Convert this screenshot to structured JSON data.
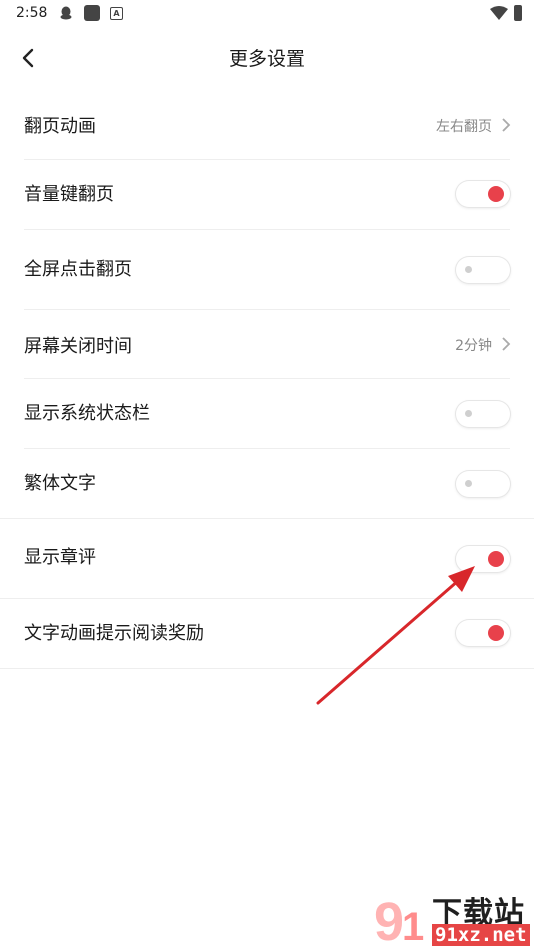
{
  "status_bar": {
    "time": "2:58"
  },
  "header": {
    "title": "更多设置"
  },
  "settings": {
    "page_turn_animation": {
      "label": "翻页动画",
      "value": "左右翻页"
    },
    "volume_key_page_turn": {
      "label": "音量键翻页",
      "enabled": true
    },
    "fullscreen_tap_page_turn": {
      "label": "全屏点击翻页",
      "enabled": false
    },
    "screen_off_time": {
      "label": "屏幕关闭时间",
      "value": "2分钟"
    },
    "show_status_bar": {
      "label": "显示系统状态栏",
      "enabled": false
    },
    "traditional_text": {
      "label": "繁体文字",
      "enabled": false
    },
    "show_chapter_comments": {
      "label": "显示章评",
      "enabled": true
    },
    "text_animation_reading_reward": {
      "label": "文字动画提示阅读奖励",
      "enabled": true
    }
  },
  "colors": {
    "toggle_on": "#e8414b",
    "annotation_arrow": "#d8272b"
  },
  "watermark": {
    "title": "下载站",
    "domain": "91xz.net"
  }
}
